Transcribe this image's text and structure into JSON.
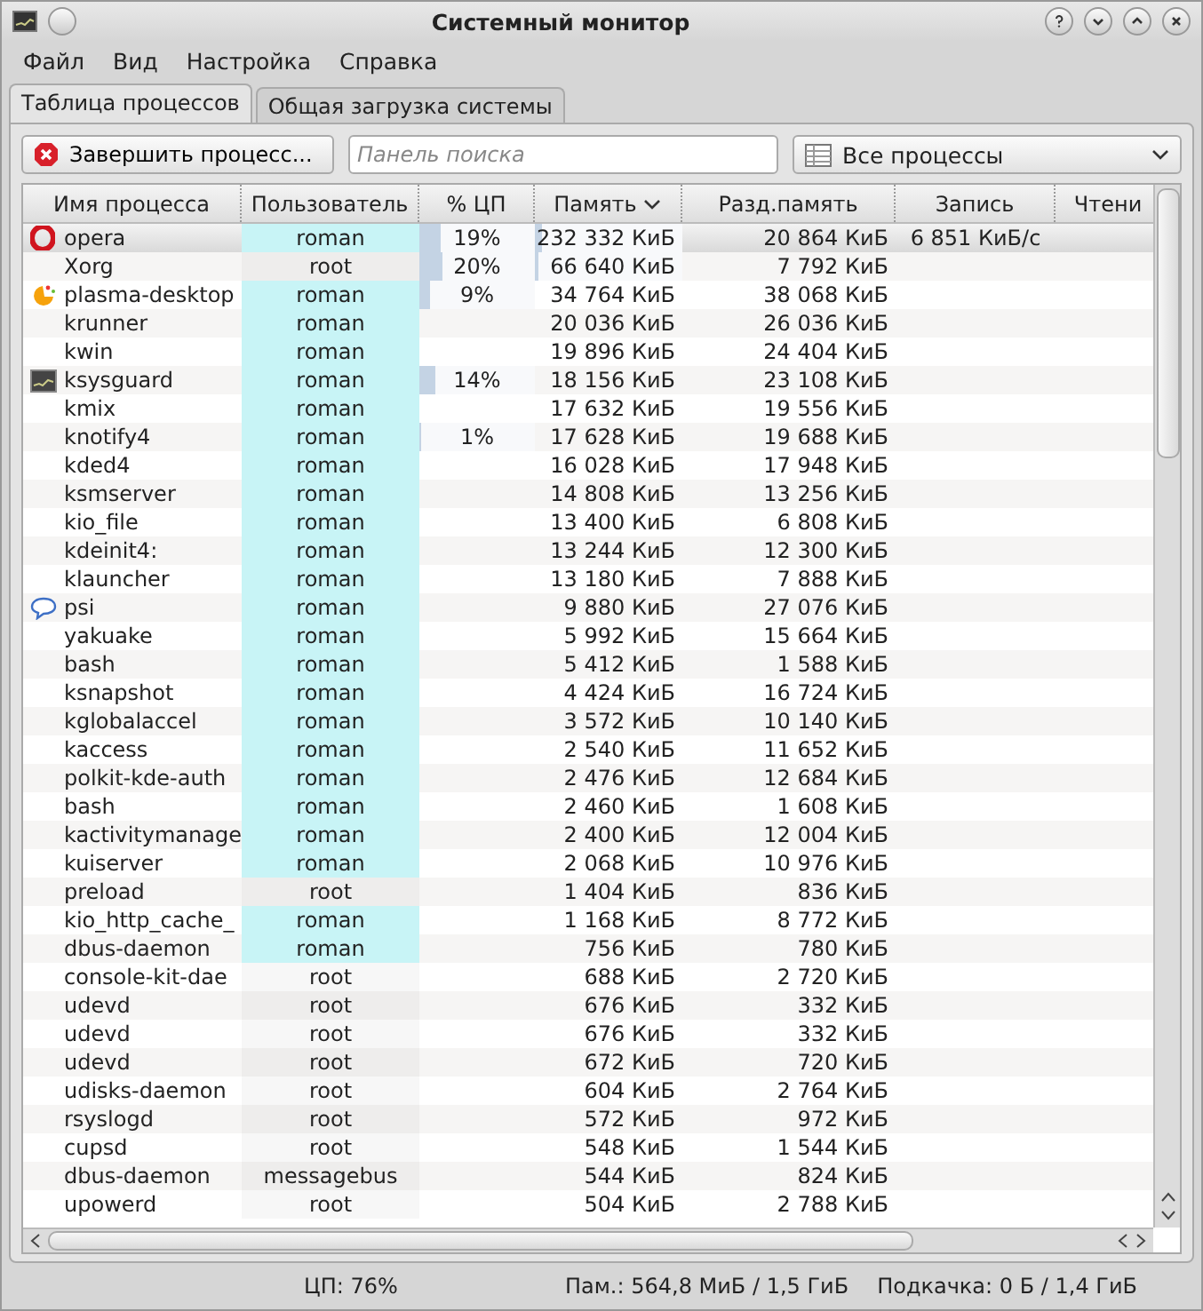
{
  "window": {
    "title": "Системный монитор"
  },
  "menu": [
    "Файл",
    "Вид",
    "Настройка",
    "Справка"
  ],
  "tabs": [
    {
      "label": "Таблица процессов",
      "selected": true
    },
    {
      "label": "Общая загрузка системы",
      "selected": false
    }
  ],
  "toolbar": {
    "kill_button": "Завершить процесс...",
    "search": {
      "placeholder": "Панель поиска"
    },
    "filter": "Все процессы"
  },
  "table": {
    "columns": [
      {
        "label": "Имя процесса",
        "sorted": false
      },
      {
        "label": "Пользователь",
        "sorted": false
      },
      {
        "label": "% ЦП",
        "sorted": false
      },
      {
        "label": "Память",
        "sorted": true
      },
      {
        "label": "Разд.память",
        "sorted": false
      },
      {
        "label": "Запись",
        "sorted": false
      },
      {
        "label": "Чтени",
        "sorted": false
      }
    ],
    "rows": [
      {
        "name": "opera",
        "kind": "opera",
        "user": "roman",
        "own": true,
        "selected": true,
        "cpu": {
          "text": "19%",
          "level": 0.19
        },
        "memory": {
          "text": "232 332 КиБ",
          "level": 0.05
        },
        "shared": "20 864 КиБ",
        "write": "6 851 КиБ/с"
      },
      {
        "name": "Xorg",
        "user": "root",
        "own": false,
        "selected": false,
        "cpu": {
          "text": "20%",
          "level": 0.2
        },
        "memory": {
          "text": "66 640 КиБ",
          "level": 0.02
        },
        "shared": "7 792 КиБ"
      },
      {
        "name": "plasma-desktop",
        "kind": "plasma",
        "user": "roman",
        "own": true,
        "selected": false,
        "cpu": {
          "text": "9%",
          "level": 0.09
        },
        "memory": {
          "text": "34 764 КиБ"
        },
        "shared": "38 068 КиБ"
      },
      {
        "name": "krunner",
        "user": "roman",
        "own": true,
        "selected": false,
        "memory": {
          "text": "20 036 КиБ"
        },
        "shared": "26 036 КиБ"
      },
      {
        "name": "kwin",
        "user": "roman",
        "own": true,
        "selected": false,
        "memory": {
          "text": "19 896 КиБ"
        },
        "shared": "24 404 КиБ"
      },
      {
        "name": "ksysguard",
        "kind": "monitor",
        "user": "roman",
        "own": true,
        "selected": false,
        "cpu": {
          "text": "14%",
          "level": 0.14
        },
        "memory": {
          "text": "18 156 КиБ"
        },
        "shared": "23 108 КиБ"
      },
      {
        "name": "kmix",
        "user": "roman",
        "own": true,
        "selected": false,
        "memory": {
          "text": "17 632 КиБ"
        },
        "shared": "19 556 КиБ"
      },
      {
        "name": "knotify4",
        "user": "roman",
        "own": true,
        "selected": false,
        "cpu": {
          "text": "1%",
          "level": 0.01
        },
        "memory": {
          "text": "17 628 КиБ"
        },
        "shared": "19 688 КиБ"
      },
      {
        "name": "kded4",
        "user": "roman",
        "own": true,
        "selected": false,
        "memory": {
          "text": "16 028 КиБ"
        },
        "shared": "17 948 КиБ"
      },
      {
        "name": "ksmserver",
        "user": "roman",
        "own": true,
        "selected": false,
        "memory": {
          "text": "14 808 КиБ"
        },
        "shared": "13 256 КиБ"
      },
      {
        "name": "kio_file",
        "user": "roman",
        "own": true,
        "selected": false,
        "memory": {
          "text": "13 400 КиБ"
        },
        "shared": "6 808 КиБ"
      },
      {
        "name": "kdeinit4:",
        "user": "roman",
        "own": true,
        "selected": false,
        "memory": {
          "text": "13 244 КиБ"
        },
        "shared": "12 300 КиБ"
      },
      {
        "name": "klauncher",
        "user": "roman",
        "own": true,
        "selected": false,
        "memory": {
          "text": "13 180 КиБ"
        },
        "shared": "7 888 КиБ"
      },
      {
        "name": "psi",
        "kind": "chat",
        "user": "roman",
        "own": true,
        "selected": false,
        "memory": {
          "text": "9 880 КиБ"
        },
        "shared": "27 076 КиБ"
      },
      {
        "name": "yakuake",
        "user": "roman",
        "own": true,
        "selected": false,
        "memory": {
          "text": "5 992 КиБ"
        },
        "shared": "15 664 КиБ"
      },
      {
        "name": "bash",
        "user": "roman",
        "own": true,
        "selected": false,
        "memory": {
          "text": "5 412 КиБ"
        },
        "shared": "1 588 КиБ"
      },
      {
        "name": "ksnapshot",
        "user": "roman",
        "own": true,
        "selected": false,
        "memory": {
          "text": "4 424 КиБ"
        },
        "shared": "16 724 КиБ"
      },
      {
        "name": "kglobalaccel",
        "user": "roman",
        "own": true,
        "selected": false,
        "memory": {
          "text": "3 572 КиБ"
        },
        "shared": "10 140 КиБ"
      },
      {
        "name": "kaccess",
        "user": "roman",
        "own": true,
        "selected": false,
        "memory": {
          "text": "2 540 КиБ"
        },
        "shared": "11 652 КиБ"
      },
      {
        "name": "polkit-kde-auth",
        "user": "roman",
        "own": true,
        "selected": false,
        "memory": {
          "text": "2 476 КиБ"
        },
        "shared": "12 684 КиБ"
      },
      {
        "name": "bash",
        "user": "roman",
        "own": true,
        "selected": false,
        "memory": {
          "text": "2 460 КиБ"
        },
        "shared": "1 608 КиБ"
      },
      {
        "name": "kactivitymanage",
        "user": "roman",
        "own": true,
        "selected": false,
        "memory": {
          "text": "2 400 КиБ"
        },
        "shared": "12 004 КиБ"
      },
      {
        "name": "kuiserver",
        "user": "roman",
        "own": true,
        "selected": false,
        "memory": {
          "text": "2 068 КиБ"
        },
        "shared": "10 976 КиБ"
      },
      {
        "name": "preload",
        "user": "root",
        "own": false,
        "selected": false,
        "memory": {
          "text": "1 404 КиБ"
        },
        "shared": "836 КиБ"
      },
      {
        "name": "kio_http_cache_",
        "user": "roman",
        "own": true,
        "selected": false,
        "memory": {
          "text": "1 168 КиБ"
        },
        "shared": "8 772 КиБ"
      },
      {
        "name": "dbus-daemon",
        "user": "roman",
        "own": true,
        "selected": false,
        "memory": {
          "text": "756 КиБ"
        },
        "shared": "780 КиБ"
      },
      {
        "name": "console-kit-dae",
        "user": "root",
        "own": false,
        "selected": false,
        "memory": {
          "text": "688 КиБ"
        },
        "shared": "2 720 КиБ"
      },
      {
        "name": "udevd",
        "user": "root",
        "own": false,
        "selected": false,
        "memory": {
          "text": "676 КиБ"
        },
        "shared": "332 КиБ"
      },
      {
        "name": "udevd",
        "user": "root",
        "own": false,
        "selected": false,
        "memory": {
          "text": "676 КиБ"
        },
        "shared": "332 КиБ"
      },
      {
        "name": "udevd",
        "user": "root",
        "own": false,
        "selected": false,
        "memory": {
          "text": "672 КиБ"
        },
        "shared": "720 КиБ"
      },
      {
        "name": "udisks-daemon",
        "user": "root",
        "own": false,
        "selected": false,
        "memory": {
          "text": "604 КиБ"
        },
        "shared": "2 764 КиБ"
      },
      {
        "name": "rsyslogd",
        "user": "root",
        "own": false,
        "selected": false,
        "memory": {
          "text": "572 КиБ"
        },
        "shared": "972 КиБ"
      },
      {
        "name": "cupsd",
        "user": "root",
        "own": false,
        "selected": false,
        "memory": {
          "text": "548 КиБ"
        },
        "shared": "1 544 КиБ"
      },
      {
        "name": "dbus-daemon",
        "user": "messagebus",
        "own": false,
        "selected": false,
        "memory": {
          "text": "544 КиБ"
        },
        "shared": "824 КиБ"
      },
      {
        "name": "upowerd",
        "user": "root",
        "own": false,
        "selected": false,
        "memory": {
          "text": "504 КиБ"
        },
        "shared": "2 788 КиБ"
      }
    ]
  },
  "status_bar": [
    "ЦП: 76%",
    "Пам.: 564,8 МиБ / 1,5 ГиБ",
    "Подкачка: 0 Б / 1,4 ГиБ"
  ]
}
